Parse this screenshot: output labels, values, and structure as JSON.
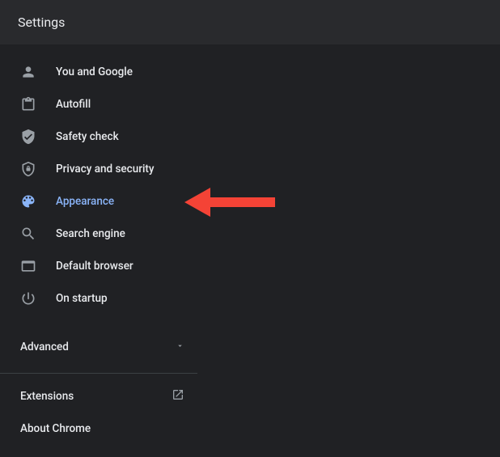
{
  "header": {
    "title": "Settings"
  },
  "sidebar": {
    "items": [
      {
        "label": "You and Google",
        "icon": "person-icon"
      },
      {
        "label": "Autofill",
        "icon": "clipboard-icon"
      },
      {
        "label": "Safety check",
        "icon": "shield-check-icon"
      },
      {
        "label": "Privacy and security",
        "icon": "shield-icon"
      },
      {
        "label": "Appearance",
        "icon": "palette-icon",
        "active": true
      },
      {
        "label": "Search engine",
        "icon": "search-icon"
      },
      {
        "label": "Default browser",
        "icon": "browser-icon"
      },
      {
        "label": "On startup",
        "icon": "power-icon"
      }
    ],
    "advanced_label": "Advanced",
    "extensions_label": "Extensions",
    "about_label": "About Chrome"
  },
  "annotation": {
    "arrow_color": "#f44336",
    "target": "Appearance"
  }
}
